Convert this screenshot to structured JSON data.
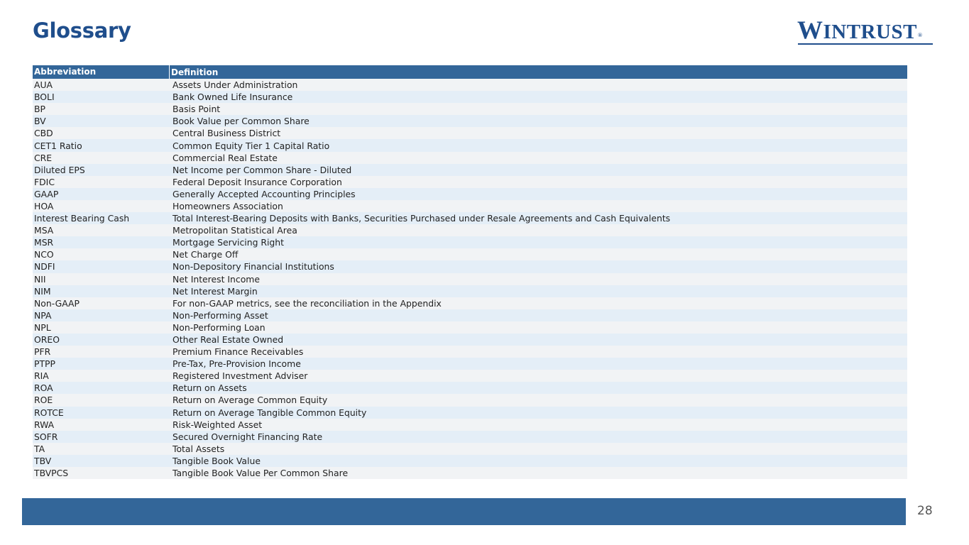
{
  "header": {
    "title": "Glossary"
  },
  "logo": {
    "text_first": "W",
    "text_rest": "INTRUST",
    "reg_mark": "®"
  },
  "table": {
    "columns": [
      "Abbreviation",
      "Definition"
    ],
    "rows": [
      [
        "AUA",
        "Assets Under Administration"
      ],
      [
        "BOLI",
        "Bank Owned Life Insurance"
      ],
      [
        "BP",
        "Basis Point"
      ],
      [
        "BV",
        "Book Value per Common Share"
      ],
      [
        "CBD",
        "Central Business District"
      ],
      [
        "CET1 Ratio",
        "Common Equity Tier 1 Capital Ratio"
      ],
      [
        "CRE",
        "Commercial Real Estate"
      ],
      [
        "Diluted EPS",
        "Net Income per Common Share - Diluted"
      ],
      [
        "FDIC",
        "Federal Deposit Insurance Corporation"
      ],
      [
        "GAAP",
        "Generally Accepted Accounting Principles"
      ],
      [
        "HOA",
        "Homeowners Association"
      ],
      [
        "Interest Bearing Cash",
        "Total Interest-Bearing Deposits with Banks, Securities Purchased under Resale Agreements and Cash Equivalents"
      ],
      [
        "MSA",
        "Metropolitan Statistical Area"
      ],
      [
        "MSR",
        "Mortgage Servicing Right"
      ],
      [
        "NCO",
        "Net Charge Off"
      ],
      [
        "NDFI",
        "Non-Depository Financial Institutions"
      ],
      [
        "NII",
        "Net Interest Income"
      ],
      [
        "NIM",
        "Net Interest Margin"
      ],
      [
        "Non-GAAP",
        "For non-GAAP metrics, see the reconciliation in the Appendix"
      ],
      [
        "NPA",
        "Non-Performing Asset"
      ],
      [
        "NPL",
        "Non-Performing Loan"
      ],
      [
        "OREO",
        "Other Real Estate Owned"
      ],
      [
        "PFR",
        "Premium Finance Receivables"
      ],
      [
        "PTPP",
        "Pre-Tax, Pre-Provision Income"
      ],
      [
        "RIA",
        "Registered Investment Adviser"
      ],
      [
        "ROA",
        "Return on Assets"
      ],
      [
        "ROE",
        "Return on Average Common Equity"
      ],
      [
        "ROTCE",
        "Return on Average Tangible Common Equity"
      ],
      [
        "RWA",
        "Risk-Weighted Asset"
      ],
      [
        "SOFR",
        "Secured Overnight Financing Rate"
      ],
      [
        "TA",
        "Total Assets"
      ],
      [
        "TBV",
        "Tangible Book Value"
      ],
      [
        "TBVPCS",
        "Tangible Book Value Per Common Share"
      ]
    ]
  },
  "footer": {
    "page_number": "28"
  },
  "colors": {
    "brand_blue": "#1f4e8c",
    "bar_blue": "#336699",
    "row_alt": "#e4eef7",
    "row_base": "#f1f3f5"
  }
}
